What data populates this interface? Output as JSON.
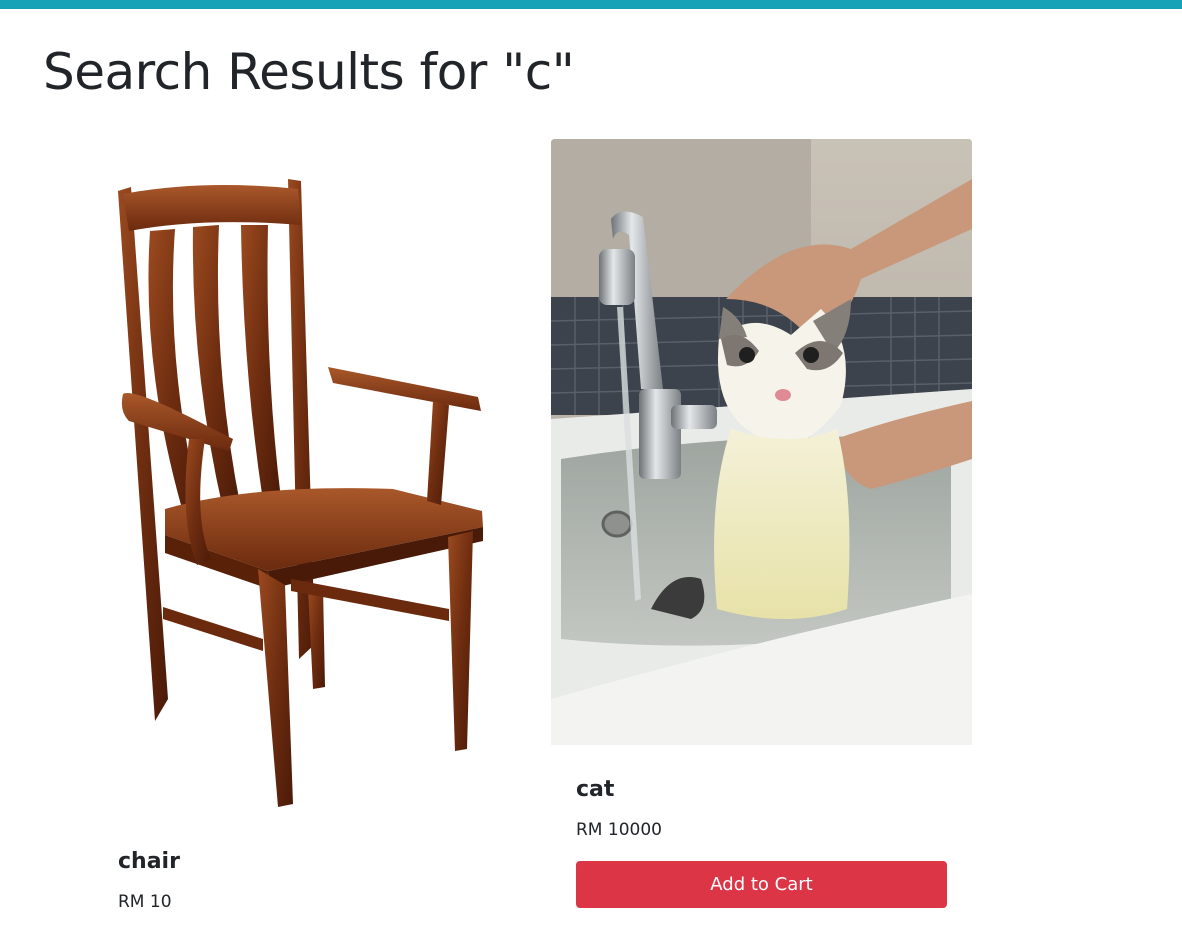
{
  "page": {
    "title": "Search Results for \"c\"",
    "accent_color": "#17a2b8"
  },
  "products": [
    {
      "name": "chair",
      "price": "RM 10",
      "image_icon": "wooden-chair-image"
    },
    {
      "name": "cat",
      "price": "RM 10000",
      "image_icon": "cat-in-sink-image",
      "button_label": "Add to Cart",
      "button_color": "#dc3545"
    }
  ]
}
